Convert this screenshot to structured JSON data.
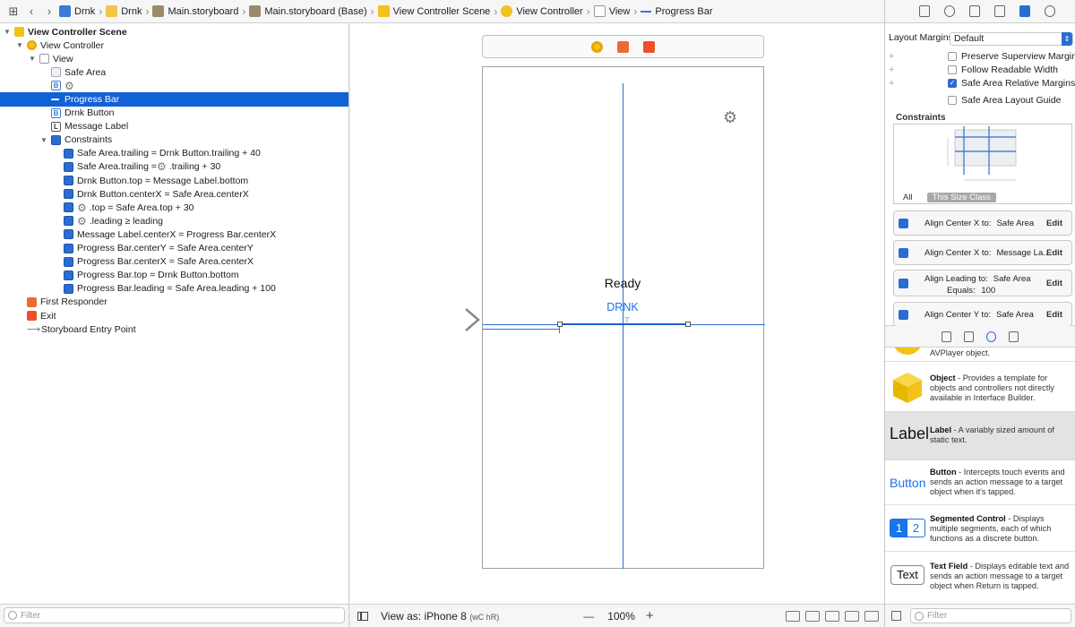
{
  "jumpbar": {
    "crumbs": [
      "Drnk",
      "Drnk",
      "Main.storyboard",
      "Main.storyboard (Base)",
      "View Controller Scene",
      "View Controller",
      "View",
      "Progress Bar"
    ]
  },
  "outline": {
    "rows": [
      {
        "label": "View Controller Scene",
        "level": 0,
        "icon": "scene-icon",
        "disclosure": "open",
        "bold": true
      },
      {
        "label": "View Controller",
        "level": 1,
        "icon": "view-controller-icon",
        "disclosure": "open"
      },
      {
        "label": "View",
        "level": 2,
        "icon": "view-icon",
        "disclosure": "open"
      },
      {
        "label": "Safe Area",
        "level": 3,
        "icon": "safe-area-icon"
      },
      {
        "label": "",
        "level": 3,
        "icon": "button-icon",
        "gear": true
      },
      {
        "label": "Progress Bar",
        "level": 3,
        "icon": "progress-bar-icon",
        "selected": true
      },
      {
        "label": "Drnk Button",
        "level": 3,
        "icon": "button-icon"
      },
      {
        "label": "Message Label",
        "level": 3,
        "icon": "label-icon"
      },
      {
        "label": "Constraints",
        "level": 3,
        "icon": "constraints-icon",
        "disclosure": "open"
      },
      {
        "label": "Safe Area.trailing = Drnk Button.trailing + 40",
        "level": 4,
        "icon": "constraint-icon"
      },
      {
        "label": "Safe Area.trailing = ",
        "suffix": ".trailing + 30",
        "gear": true,
        "level": 4,
        "icon": "constraint-icon"
      },
      {
        "label": "Drnk Button.top = Message Label.bottom",
        "level": 4,
        "icon": "constraint-icon"
      },
      {
        "label": "Drnk Button.centerX = Safe Area.centerX",
        "level": 4,
        "icon": "constraint-icon"
      },
      {
        "label": "",
        "suffix": ".top = Safe Area.top + 30",
        "gear": true,
        "level": 4,
        "icon": "constraint-icon"
      },
      {
        "label": "",
        "suffix": ".leading ≥ leading",
        "gear": true,
        "level": 4,
        "icon": "constraint-icon"
      },
      {
        "label": "Message Label.centerX = Progress Bar.centerX",
        "level": 4,
        "icon": "constraint-icon"
      },
      {
        "label": "Progress Bar.centerY = Safe Area.centerY",
        "level": 4,
        "icon": "constraint-icon"
      },
      {
        "label": "Progress Bar.centerX = Safe Area.centerX",
        "level": 4,
        "icon": "constraint-icon"
      },
      {
        "label": "Progress Bar.top = Drnk Button.bottom",
        "level": 4,
        "icon": "constraint-icon"
      },
      {
        "label": "Progress Bar.leading = Safe Area.leading + 100",
        "level": 4,
        "icon": "constraint-icon"
      },
      {
        "label": "First Responder",
        "level": 1,
        "icon": "first-responder-icon"
      },
      {
        "label": "Exit",
        "level": 1,
        "icon": "exit-icon"
      },
      {
        "label": "Storyboard Entry Point",
        "level": 1,
        "icon": "entry-point-icon"
      }
    ],
    "filter_placeholder": "Filter"
  },
  "canvas": {
    "message_label": "Ready",
    "drnk_button": "DRNK",
    "view_as": "View as: iPhone 8",
    "size_class": "(wC hR)",
    "zoom": "100%",
    "zoom_minus": "—",
    "zoom_plus": "+"
  },
  "inspector": {
    "layout_margins_label": "Layout Margins",
    "layout_margins_value": "Default",
    "checks": [
      {
        "label": "Preserve Superview Margins",
        "checked": false
      },
      {
        "label": "Follow Readable Width",
        "checked": false
      },
      {
        "label": "Safe Area Relative Margins",
        "checked": true
      },
      {
        "label": "Safe Area Layout Guide",
        "checked": false
      }
    ],
    "constraints_title": "Constraints",
    "tab_all": "All",
    "tab_size_class": "This Size Class",
    "constraints": [
      {
        "label": "Align Center X to:",
        "target": "Safe Area",
        "edit": "Edit"
      },
      {
        "label": "Align Center X to:",
        "target": "Message La...",
        "edit": "Edit"
      },
      {
        "label": "Align Leading to:",
        "target": "Safe Area",
        "equals_label": "Equals:",
        "equals_value": "100",
        "edit": "Edit"
      },
      {
        "label": "Align Center Y to:",
        "target": "Safe Area",
        "edit": "Edit"
      }
    ]
  },
  "library": {
    "items": [
      {
        "name": "",
        "desc": "AVPlayer object."
      },
      {
        "name": "Object",
        "desc": " - Provides a template for objects and controllers not directly available in Interface Builder."
      },
      {
        "name": "Label",
        "desc": " - A variably sized amount of static text.",
        "sample": "Label"
      },
      {
        "name": "Button",
        "desc": " - Intercepts touch events and sends an action message to a target object when it's tapped.",
        "sample": "Button"
      },
      {
        "name": "Segmented Control",
        "desc": " - Displays multiple segments, each of which functions as a discrete button.",
        "sample_a": "1",
        "sample_b": "2"
      },
      {
        "name": "Text Field",
        "desc": " - Displays editable text and sends an action message to a target object when Return is tapped.",
        "sample": "Text"
      }
    ],
    "filter_placeholder": "Filter"
  },
  "colors": {
    "accent": "#1162d6",
    "guide": "#2d6fd2",
    "scene_yellow": "#f2c11b",
    "first_responder": "#ef6a2f"
  }
}
